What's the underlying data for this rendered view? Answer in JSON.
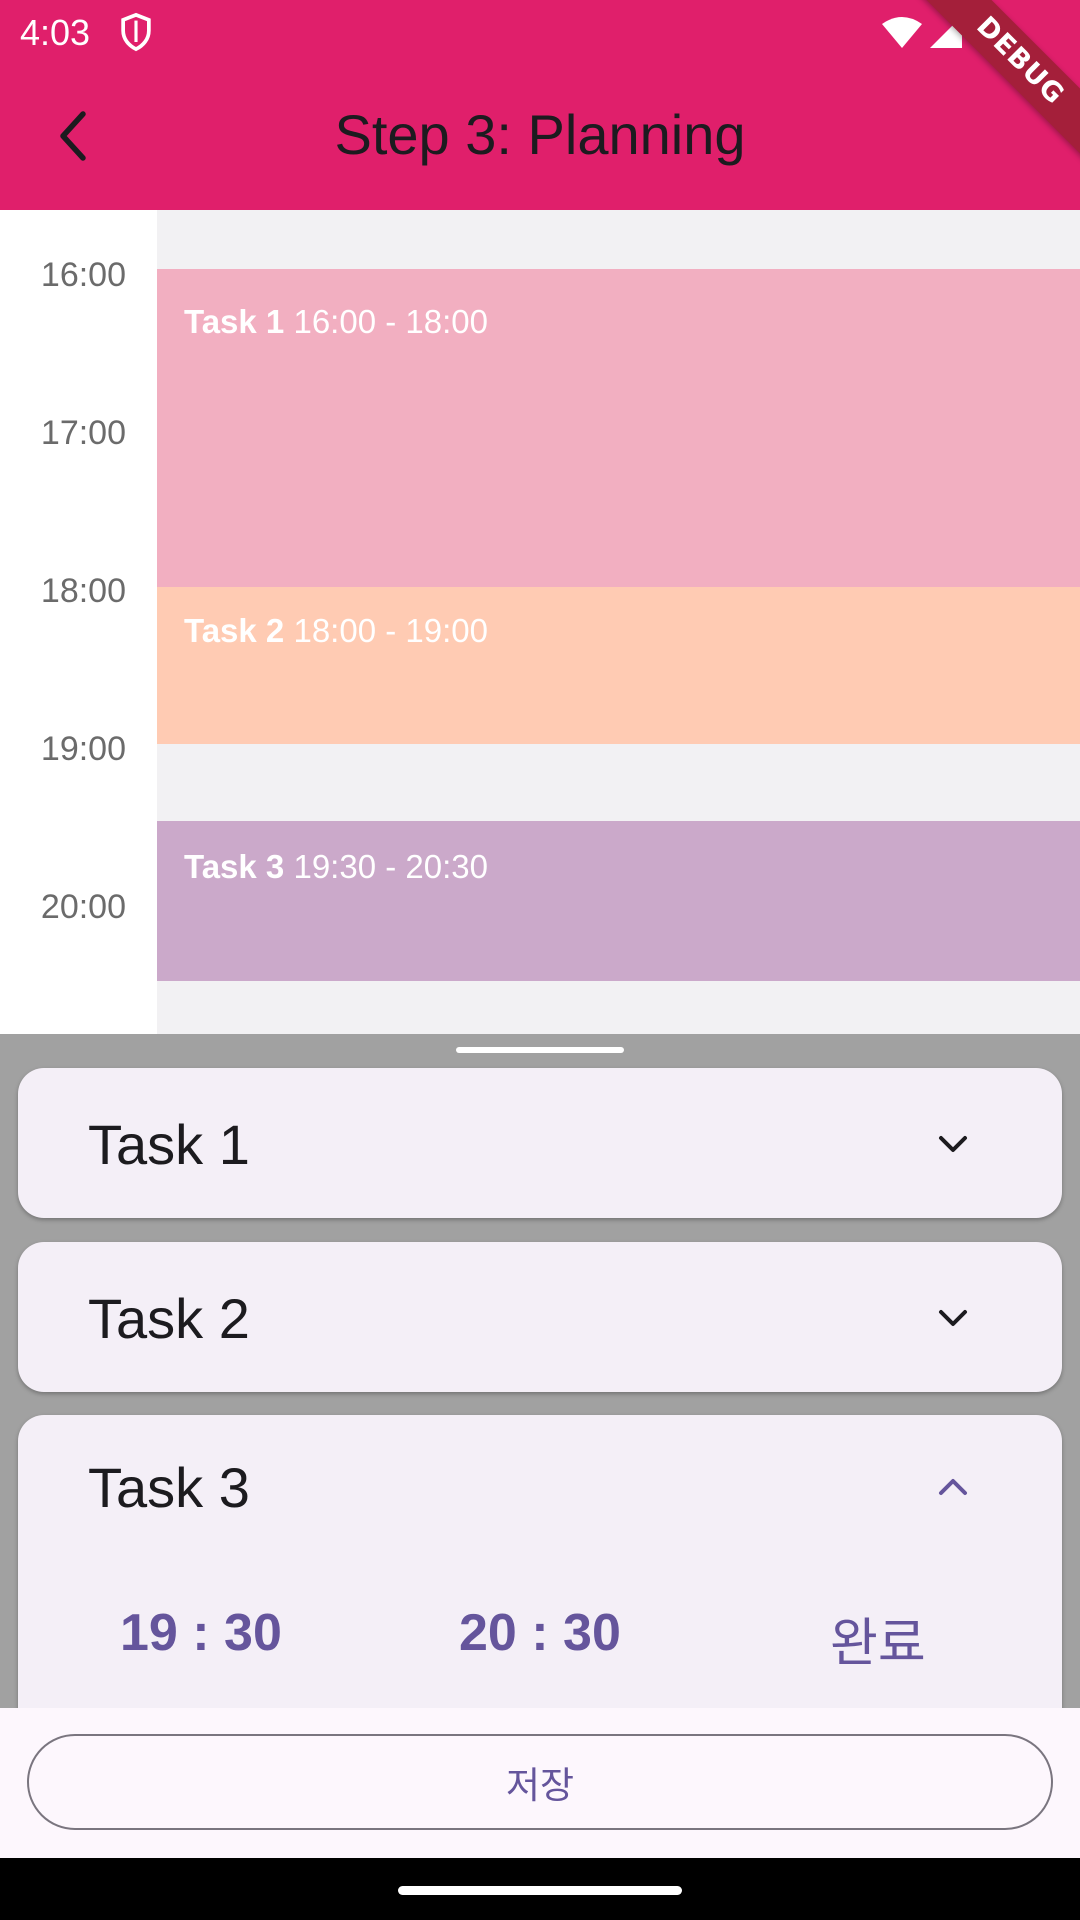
{
  "status_bar": {
    "time": "4:03",
    "icons": [
      "shield-icon",
      "wifi-icon",
      "signal-icon",
      "battery-icon"
    ]
  },
  "app_bar": {
    "title": "Step 3: Planning",
    "back_icon": "back-arrow-icon",
    "debug_banner": "DEBUG"
  },
  "schedule": {
    "hours": [
      "16:00",
      "17:00",
      "18:00",
      "19:00",
      "20:00"
    ],
    "events": [
      {
        "name": "Task 1",
        "time": "16:00 - 18:00",
        "color": "#f2afc1"
      },
      {
        "name": "Task 2",
        "time": "18:00 - 19:00",
        "color": "#ffcbb3"
      },
      {
        "name": "Task 3",
        "time": "19:30 - 20:30",
        "color": "#cba9ca"
      }
    ]
  },
  "sheet": {
    "tasks": [
      {
        "title": "Task 1",
        "expanded": false
      },
      {
        "title": "Task 2",
        "expanded": false
      },
      {
        "title": "Task 3",
        "expanded": true,
        "start": "19 : 30",
        "end": "20 : 30",
        "done_label": "완료"
      }
    ]
  },
  "footer": {
    "save_label": "저장"
  },
  "colors": {
    "app_bar": "#e01f6b",
    "accent": "#65559c",
    "card": "#f4eff7",
    "scrim": "#a1a1a1"
  }
}
